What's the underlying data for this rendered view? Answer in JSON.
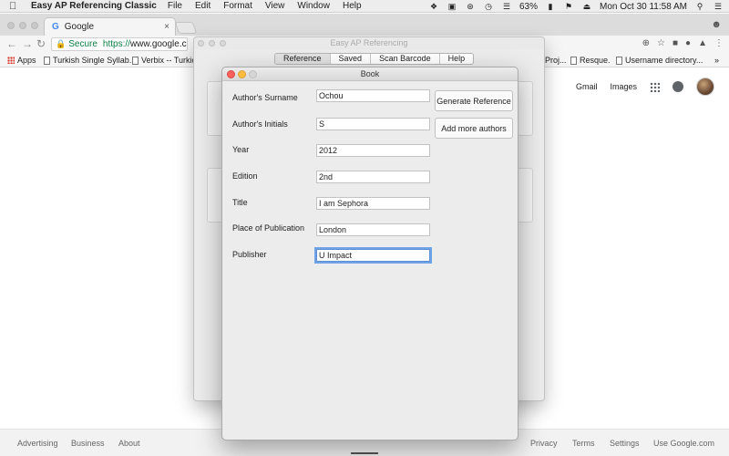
{
  "menubar": {
    "app_name": "Easy AP Referencing Classic",
    "menus": [
      "File",
      "Edit",
      "Format",
      "View",
      "Window",
      "Help"
    ],
    "battery": "63%",
    "datetime": "Mon Oct 30  11:58 AM"
  },
  "browser": {
    "tab_title": "Google",
    "tab_close": "×",
    "secure_label": "Secure",
    "url_scheme": "https://",
    "url_rest": "www.google.com...",
    "bookmarks": [
      "Apps",
      "Turkish Single Syllab...",
      "Verbix -- Turkic",
      "Proj...",
      "Resque.",
      "Username directory..."
    ]
  },
  "google": {
    "header_links": [
      "Gmail",
      "Images"
    ],
    "footer_left": [
      "Advertising",
      "Business",
      "About"
    ],
    "footer_right": [
      "Privacy",
      "Terms",
      "Settings",
      "Use Google.com"
    ]
  },
  "app": {
    "window_title": "Easy AP Referencing",
    "tabs": [
      "Reference",
      "Saved",
      "Scan Barcode",
      "Help"
    ],
    "active_tab": "Reference"
  },
  "book_dialog": {
    "title": "Book",
    "fields": [
      {
        "label": "Author's Surname",
        "value": "Ochou"
      },
      {
        "label": "Author's Initials",
        "value": "S"
      },
      {
        "label": "Year",
        "value": "2012"
      },
      {
        "label": "Edition",
        "value": "2nd"
      },
      {
        "label": "Title",
        "value": "I am Sephora"
      },
      {
        "label": "Place of Publication",
        "value": "London"
      },
      {
        "label": "Publisher",
        "value": "U Impact"
      }
    ],
    "buttons": {
      "generate": "Generate Reference",
      "add_authors": "Add more authors"
    }
  }
}
